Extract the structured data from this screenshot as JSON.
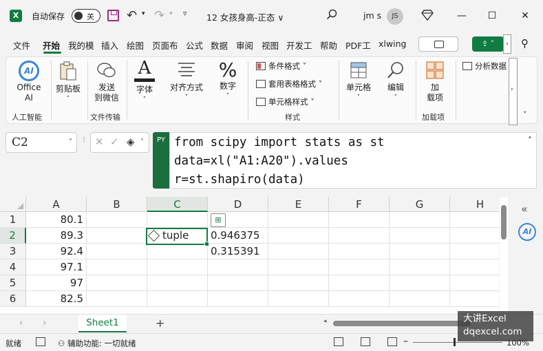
{
  "titlebar": {
    "autosave_label": "自动保存",
    "autosave_state": "关",
    "doc_title": "12 女孩身高-正态 ∨",
    "user_name": "jm s",
    "avatar_initials": "JS"
  },
  "tabs": [
    "文件",
    "开始",
    "我的模",
    "插入",
    "绘图",
    "页面布",
    "公式",
    "数据",
    "审阅",
    "视图",
    "开发工",
    "帮助",
    "PDF工",
    "xlwing"
  ],
  "ribbon": {
    "office_ai": "Office AI",
    "clipboard": "剪贴板",
    "send_wechat_1": "发送",
    "send_wechat_2": "到微信",
    "font": "字体",
    "align": "对齐方式",
    "number": "数字",
    "cond_format": "条件格式 ˅",
    "table_format": "套用表格格式 ˅",
    "cell_style": "单元格样式 ˅",
    "cells": "单元格",
    "edit": "编辑",
    "addin_1": "加",
    "addin_2": "载项",
    "analyze": "分析数据",
    "groups": {
      "ai": "人工智能",
      "file_transfer": "文件传输",
      "styles": "样式",
      "addins": "加载项"
    }
  },
  "formula_bar": {
    "name_box": "C2",
    "py_badge": "PY",
    "lines": [
      "from scipy import stats as st",
      "data=xl(\"A1:A20\").values",
      "r=st.shapiro(data)"
    ]
  },
  "grid": {
    "columns": [
      "A",
      "B",
      "C",
      "D",
      "E",
      "F",
      "G",
      "H"
    ],
    "rows": [
      "1",
      "2",
      "3",
      "4",
      "5",
      "6"
    ],
    "col_a": [
      "80.1",
      "89.3",
      "92.4",
      "97.1",
      "97",
      "82.5"
    ],
    "c2_value": "tuple",
    "d2_value": "0.946375",
    "d3_value": "0.315391"
  },
  "sheets": {
    "active": "Sheet1",
    "add": "+"
  },
  "statusbar": {
    "ready": "就绪",
    "accessibility": "辅助功能: 一切就绪",
    "zoom": "100%"
  },
  "watermark": {
    "line1": "大讲Excel",
    "line2": "dqexcel.com"
  },
  "colors": {
    "excel_green": "#107c41",
    "save_purple": "#9b2a83",
    "ai_blue": "#3a86d4"
  }
}
